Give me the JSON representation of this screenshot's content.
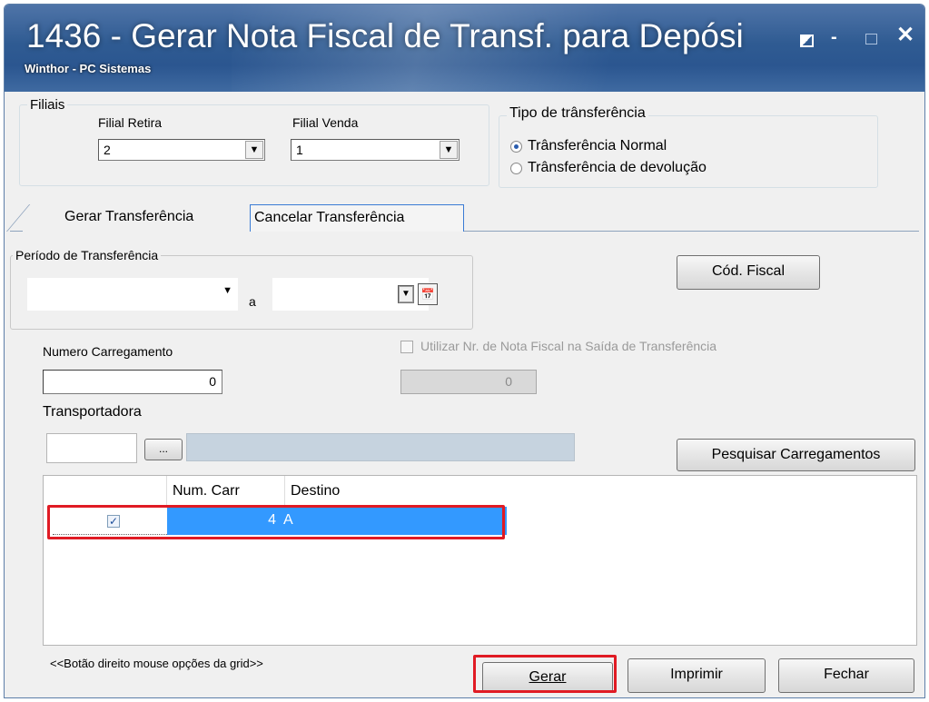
{
  "window": {
    "title": "1436 - Gerar Nota Fiscal de Transf. para Depósi",
    "subtitle": "Winthor - PC Sistemas"
  },
  "filiais": {
    "legend": "Filiais",
    "retira_label": "Filial Retira",
    "retira_value": "2",
    "venda_label": "Filial Venda",
    "venda_value": "1"
  },
  "tipo": {
    "legend": "Tipo de trânsferência",
    "options": [
      {
        "label": "Trânsferência Normal",
        "selected": true
      },
      {
        "label": "Trânsferência de devolução",
        "selected": false
      }
    ]
  },
  "tabs": [
    {
      "label": "Gerar Transferência",
      "active": true
    },
    {
      "label": "Cancelar Transferência",
      "active": false
    }
  ],
  "periodo": {
    "legend": "Período de Transferência",
    "separator": "a",
    "start": "",
    "end": ""
  },
  "buttons": {
    "cod_fiscal": "Cód. Fiscal",
    "pesquisar": "Pesquisar Carregamentos",
    "ellipsis": "...",
    "gerar": "Gerar",
    "imprimir": "Imprimir",
    "fechar": "Fechar"
  },
  "carregamento": {
    "label": "Numero Carregamento",
    "value": "0"
  },
  "nota_saida": {
    "label": "Utilizar Nr. de Nota Fiscal na Saída de Transferência",
    "checked": false,
    "value": "0"
  },
  "transportadora": {
    "label": "Transportadora",
    "code": "",
    "name": ""
  },
  "grid": {
    "columns": [
      "Num. Carr",
      "Destino"
    ],
    "rows": [
      {
        "checked": true,
        "num_carr": "4",
        "destino": "A"
      }
    ]
  },
  "hint": "<<Botão direito mouse opções da grid>>",
  "colors": {
    "titlebar": "#2f5b92",
    "selection": "#3399ff",
    "highlight": "#e01b24"
  }
}
